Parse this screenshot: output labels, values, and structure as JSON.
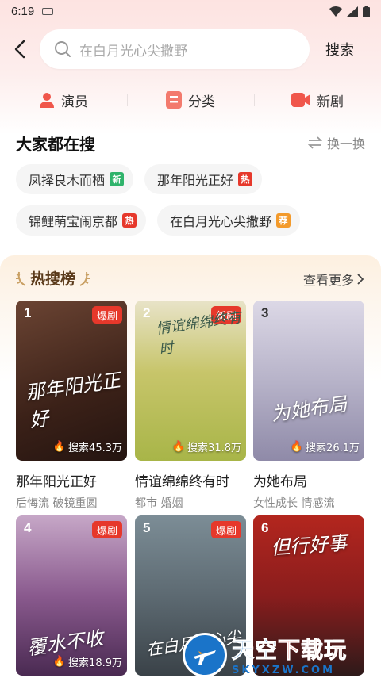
{
  "status": {
    "time": "6:19"
  },
  "search": {
    "placeholder": "在白月光心尖撒野",
    "button_label": "搜索"
  },
  "quick_nav": [
    {
      "label": "演员",
      "icon": "person-icon",
      "color": "#f0564b"
    },
    {
      "label": "分类",
      "icon": "category-icon",
      "color": "#f37a6d"
    },
    {
      "label": "新剧",
      "icon": "video-camera-icon",
      "color": "#f0564b"
    }
  ],
  "popular": {
    "title": "大家都在搜",
    "refresh_label": "换一换",
    "chips": [
      {
        "label": "凤择良木而栖",
        "tag": "新",
        "tag_color": "#2fb36b"
      },
      {
        "label": "那年阳光正好",
        "tag": "热",
        "tag_color": "#e6382b"
      },
      {
        "label": "锦鲤萌宝闹京都",
        "tag": "热",
        "tag_color": "#e6382b"
      },
      {
        "label": "在白月光心尖撒野",
        "tag": "荐",
        "tag_color": "#f39a2b"
      }
    ]
  },
  "hot": {
    "title": "热搜榜",
    "more_label": "查看更多",
    "items": [
      {
        "rank": "1",
        "badge": "爆剧",
        "heat": "搜索45.3万",
        "poster_title": "那年阳光正好",
        "name": "那年阳光正好",
        "tags": "后悔流 破镜重圆",
        "bg": "#4a2c24"
      },
      {
        "rank": "2",
        "badge": "新剧",
        "heat": "搜索31.8万",
        "poster_title": "情谊绵绵终有时",
        "name": "情谊绵绵终有时",
        "tags": "都市 婚姻",
        "bg": "#b8c25a"
      },
      {
        "rank": "3",
        "badge": "",
        "heat": "搜索26.1万",
        "poster_title": "为她布局",
        "name": "为她布局",
        "tags": "女性成长 情感流",
        "bg": "#c7bfd6"
      },
      {
        "rank": "4",
        "badge": "爆剧",
        "heat": "搜索18.9万",
        "poster_title": "覆水不收",
        "name": "",
        "tags": "",
        "bg": "#8a5a8e"
      },
      {
        "rank": "5",
        "badge": "爆剧",
        "heat": "",
        "poster_title": "在白月光心尖",
        "name": "",
        "tags": "",
        "bg": "#5d6a72"
      },
      {
        "rank": "6",
        "badge": "",
        "heat": "",
        "poster_title": "但行好事",
        "name": "",
        "tags": "",
        "bg": "#8a1d1d"
      }
    ]
  },
  "watermark": {
    "name_part1": "天空",
    "name_part2": "下载玩",
    "domain": "SKYXZW.COM"
  }
}
